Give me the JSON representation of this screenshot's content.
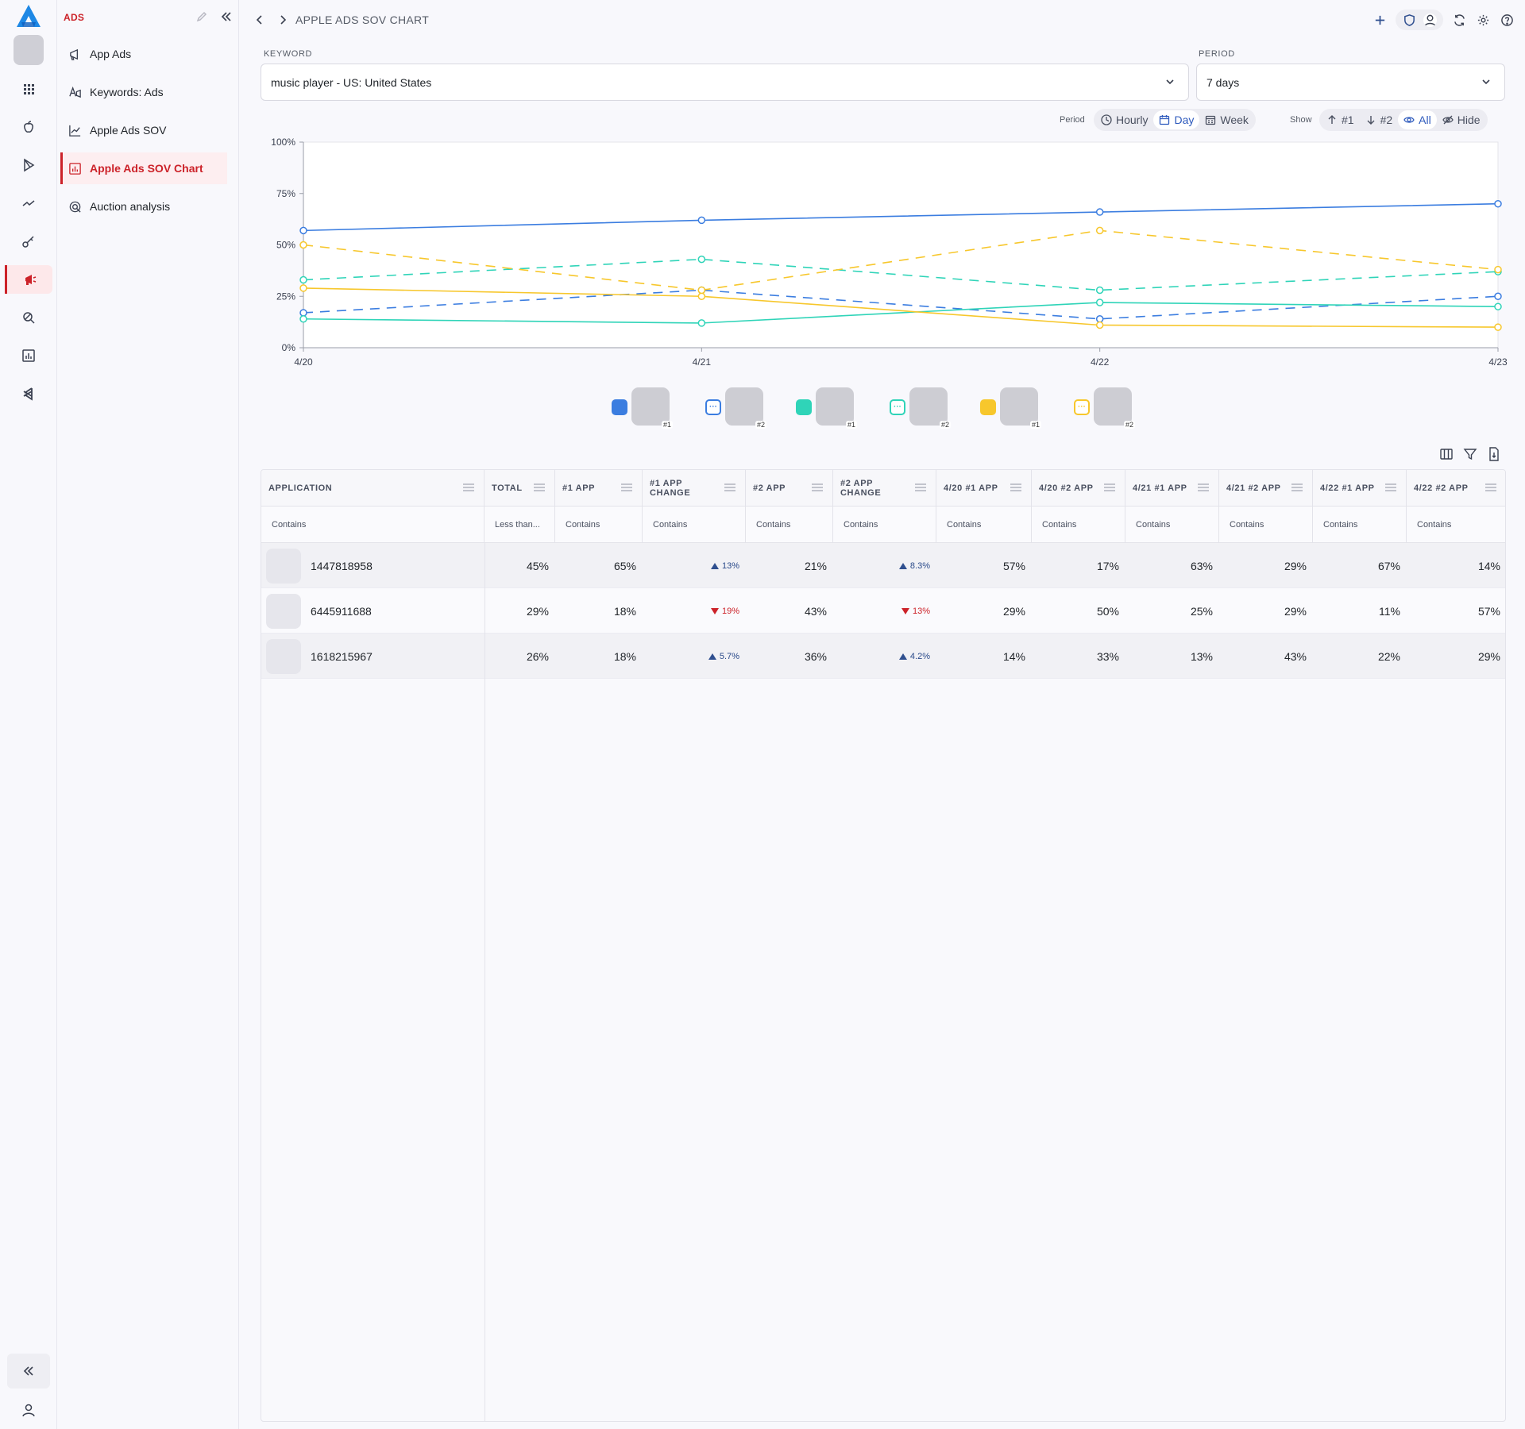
{
  "sidebar": {
    "section_title": "ADS",
    "items": [
      {
        "label": "App Ads",
        "icon": "megaphone-icon"
      },
      {
        "label": "Keywords: Ads",
        "icon": "keyword-ads-icon"
      },
      {
        "label": "Apple Ads SOV",
        "icon": "line-chart-icon"
      },
      {
        "label": "Apple Ads SOV Chart",
        "icon": "bar-chart-icon",
        "active": true
      },
      {
        "label": "Auction analysis",
        "icon": "auction-icon"
      }
    ]
  },
  "header": {
    "breadcrumb": "APPLE ADS SOV CHART"
  },
  "filters": {
    "keyword_label": "KEYWORD",
    "keyword_value": "music player - US: United States",
    "period_label": "PERIOD",
    "period_value": "7 days"
  },
  "toolbar": {
    "period_label": "Period",
    "period_options": [
      "Hourly",
      "Day",
      "Week"
    ],
    "period_selected": "Day",
    "show_label": "Show",
    "show_options": [
      "#1",
      "#2",
      "All",
      "Hide"
    ],
    "show_selected": "All"
  },
  "colors": {
    "accent": "#cc2229",
    "blue": "#3b7de0",
    "teal": "#2fd4b8",
    "yellow": "#f7c72c"
  },
  "chart_data": {
    "type": "line",
    "x": [
      "4/20",
      "4/21",
      "4/22",
      "4/23"
    ],
    "yticks": [
      "0%",
      "25%",
      "50%",
      "75%",
      "100%"
    ],
    "ylim": [
      0,
      100
    ],
    "grid": false,
    "legend": "bottom",
    "series": [
      {
        "color": "#3b7de0",
        "dash": false,
        "badge": "#1",
        "values": [
          57,
          62,
          66,
          70
        ]
      },
      {
        "color": "#3b7de0",
        "dash": true,
        "badge": "#2",
        "values": [
          17,
          28,
          14,
          25
        ]
      },
      {
        "color": "#2fd4b8",
        "dash": false,
        "badge": "#1",
        "values": [
          14,
          12,
          22,
          20
        ]
      },
      {
        "color": "#2fd4b8",
        "dash": true,
        "badge": "#2",
        "values": [
          33,
          43,
          28,
          37
        ]
      },
      {
        "color": "#f7c72c",
        "dash": false,
        "badge": "#1",
        "values": [
          29,
          25,
          11,
          10
        ]
      },
      {
        "color": "#f7c72c",
        "dash": true,
        "badge": "#2",
        "values": [
          50,
          28,
          57,
          38
        ]
      }
    ]
  },
  "table": {
    "columns": [
      "APPLICATION",
      "TOTAL",
      "#1 APP",
      "#1 APP CHANGE",
      "#2 APP",
      "#2 APP CHANGE",
      "4/20 #1 APP",
      "4/20 #2 APP",
      "4/21 #1 APP",
      "4/21 #2 APP",
      "4/22 #1 APP",
      "4/22 #2 APP"
    ],
    "filters": [
      "Contains",
      "Less than...",
      "Contains",
      "Contains",
      "Contains",
      "Contains",
      "Contains",
      "Contains",
      "Contains",
      "Contains",
      "Contains",
      "Contains"
    ],
    "rows": [
      {
        "app": "1447818958",
        "total": "45%",
        "app1": "65%",
        "app1_change": "13%",
        "app1_dir": "up",
        "app2": "21%",
        "app2_change": "8.3%",
        "app2_dir": "up",
        "d420_1": "57%",
        "d420_2": "17%",
        "d421_1": "63%",
        "d421_2": "29%",
        "d422_1": "67%",
        "d422_2": "14%"
      },
      {
        "app": "6445911688",
        "total": "29%",
        "app1": "18%",
        "app1_change": "19%",
        "app1_dir": "down",
        "app2": "43%",
        "app2_change": "13%",
        "app2_dir": "down",
        "d420_1": "29%",
        "d420_2": "50%",
        "d421_1": "25%",
        "d421_2": "29%",
        "d422_1": "11%",
        "d422_2": "57%"
      },
      {
        "app": "1618215967",
        "total": "26%",
        "app1": "18%",
        "app1_change": "5.7%",
        "app1_dir": "up",
        "app2": "36%",
        "app2_change": "4.2%",
        "app2_dir": "up",
        "d420_1": "14%",
        "d420_2": "33%",
        "d421_1": "13%",
        "d421_2": "43%",
        "d422_1": "22%",
        "d422_2": "29%"
      }
    ]
  }
}
